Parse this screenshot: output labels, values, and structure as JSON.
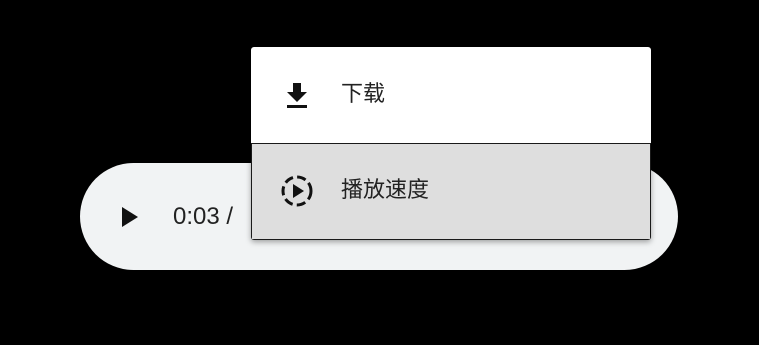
{
  "player": {
    "play_icon": "play-icon",
    "time_text": "0:03 / "
  },
  "menu": {
    "items": [
      {
        "label": "下载",
        "icon": "download-icon",
        "selected": false
      },
      {
        "label": "播放速度",
        "icon": "playback-speed-icon",
        "selected": true
      }
    ]
  },
  "colors": {
    "background": "#000000",
    "player_background": "#f1f3f4",
    "menu_background": "#ffffff",
    "menu_selected_background": "#dedede",
    "text": "#222222"
  }
}
